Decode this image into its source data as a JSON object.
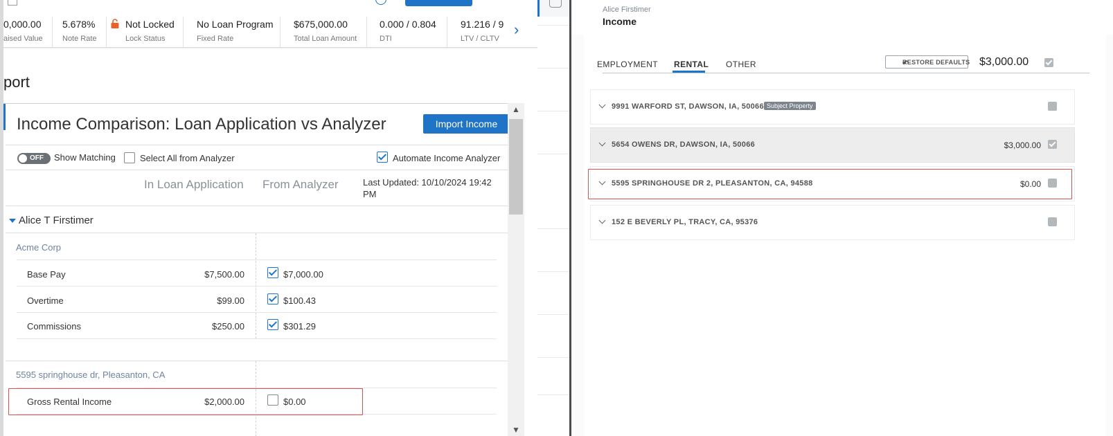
{
  "metrics": [
    {
      "value": "0,000.00",
      "label": "aised Value"
    },
    {
      "value": "5.678%",
      "label": "Note Rate"
    },
    {
      "value": "Not Locked",
      "label": "Lock Status",
      "icon": "lock-icon"
    },
    {
      "value": "No Loan Program",
      "label": "Fixed Rate"
    },
    {
      "value": "$675,000.00",
      "label": "Total Loan Amount"
    },
    {
      "value": "0.000 / 0.804",
      "label": "DTI"
    },
    {
      "value": "91.216 / 9",
      "label": "LTV / CLTV"
    }
  ],
  "page_title": "port",
  "modal": {
    "title": "Income Comparison: Loan Application vs Analyzer",
    "import_label": "Import Income",
    "toggle_label": "OFF",
    "show_matching": "Show Matching",
    "select_all": "Select All from Analyzer",
    "automate": "Automate Income Analyzer",
    "automate_checked": true,
    "col_loan_app": "In Loan Application",
    "col_analyzer": "From Analyzer",
    "last_updated": "Last Updated: 10/10/2024  19:42 PM",
    "borrower": "Alice T Firstimer",
    "employer": "Acme Corp",
    "employment_rows": [
      {
        "label": "Base Pay",
        "loan_app": "$7,500.00",
        "analyzer": "$7,000.00",
        "checked": true
      },
      {
        "label": "Overtime",
        "loan_app": "$99.00",
        "analyzer": "$100.43",
        "checked": true
      },
      {
        "label": "Commissions",
        "loan_app": "$250.00",
        "analyzer": "$301.29",
        "checked": true
      }
    ],
    "rental_section": "5595 springhouse dr, Pleasanton, CA",
    "rental_rows": [
      {
        "label": "Gross Rental Income",
        "loan_app": "$2,000.00",
        "analyzer": "$0.00",
        "checked": false
      }
    ]
  },
  "right": {
    "borrower": "Alice Firstimer",
    "title": "Income",
    "tabs": [
      "EMPLOYMENT",
      "RENTAL",
      "OTHER"
    ],
    "active_tab": "RENTAL",
    "restore_label": "RESTORE DEFAULTS",
    "total": "$3,000.00",
    "properties": [
      {
        "address": "9991 WARFORD ST, DAWSON, IA, 50066",
        "badge": "Subject Property",
        "amount": "",
        "checked": false
      },
      {
        "address": "5654 OWENS DR, DAWSON, IA, 50066",
        "badge": "",
        "amount": "$3,000.00",
        "checked": true
      },
      {
        "address": "5595 SPRINGHOUSE DR 2, PLEASANTON, CA, 94588",
        "badge": "",
        "amount": "$0.00",
        "checked": false
      },
      {
        "address": "152 E BEVERLY PL, TRACY, CA, 95376",
        "badge": "",
        "amount": "",
        "checked": false
      }
    ]
  },
  "colors": {
    "accent": "#1f74c8",
    "highlight": "#d9534f",
    "lock": "#e8632a"
  }
}
